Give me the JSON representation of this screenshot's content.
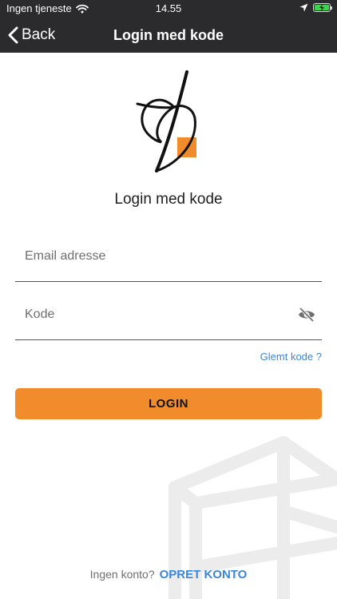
{
  "status_bar": {
    "carrier": "Ingen tjeneste",
    "time": "14.55"
  },
  "nav": {
    "back_label": "Back",
    "title": "Login med kode"
  },
  "form": {
    "heading": "Login med kode",
    "email_placeholder": "Email adresse",
    "code_placeholder": "Kode",
    "forgot_label": "Glemt kode ?",
    "login_label": "LOGIN"
  },
  "footer": {
    "question": "Ingen konto?",
    "create_label": "OPRET KONTO"
  },
  "colors": {
    "accent": "#f08c2c",
    "link": "#3a86d9",
    "navbar": "#2b2b2e"
  },
  "icons": [
    "wifi-icon",
    "location-arrow-icon",
    "battery-icon",
    "chevron-left-icon",
    "eye-slash-icon"
  ]
}
